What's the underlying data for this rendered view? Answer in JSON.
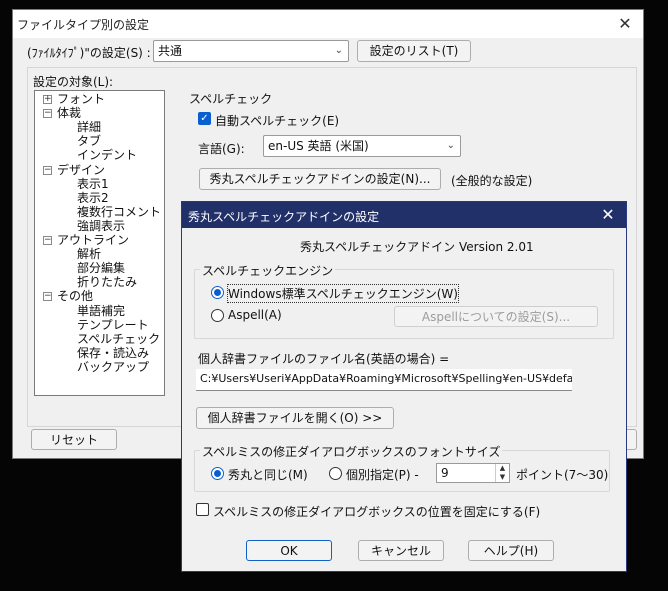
{
  "main_window": {
    "title": "ファイルタイプ別の設定",
    "filetype_label": "(ﾌｧｲﾙﾀｲﾌﾟ)\"の設定(S) :",
    "filetype_value": "共通",
    "settings_list_button": "設定のリスト(T)",
    "target_label": "設定の対象(L):",
    "tree": [
      {
        "label": "フォント",
        "toggle": "+",
        "level": 0
      },
      {
        "label": "体裁",
        "toggle": "−",
        "level": 0
      },
      {
        "label": "詳細",
        "level": 1
      },
      {
        "label": "タブ",
        "level": 1
      },
      {
        "label": "インデント",
        "level": 1
      },
      {
        "label": "デザイン",
        "toggle": "−",
        "level": 0
      },
      {
        "label": "表示1",
        "level": 1
      },
      {
        "label": "表示2",
        "level": 1
      },
      {
        "label": "複数行コメント",
        "level": 1
      },
      {
        "label": "強調表示",
        "level": 1
      },
      {
        "label": "アウトライン",
        "toggle": "−",
        "level": 0
      },
      {
        "label": "解析",
        "level": 1
      },
      {
        "label": "部分編集",
        "level": 1
      },
      {
        "label": "折りたたみ",
        "level": 1
      },
      {
        "label": "その他",
        "toggle": "−",
        "level": 0
      },
      {
        "label": "単語補完",
        "level": 1
      },
      {
        "label": "テンプレート",
        "level": 1
      },
      {
        "label": "スペルチェック",
        "level": 1
      },
      {
        "label": "保存・読込み",
        "level": 1
      },
      {
        "label": "バックアップ",
        "level": 1
      }
    ],
    "spellcheck_section_title": "スペルチェック",
    "auto_spellcheck_label": "自動スペルチェック(E)",
    "language_label": "言語(G):",
    "language_value": "en-US 英語 (米国)",
    "addin_settings_button": "秀丸スペルチェックアドインの設定(N)...",
    "general_settings_note": "(全般的な設定)",
    "reset_button": "リセット"
  },
  "dialog": {
    "title": "秀丸スペルチェックアドインの設定",
    "version": "秀丸スペルチェックアドイン Version 2.01",
    "engine_group": "スペルチェックエンジン",
    "engine_windows": "Windows標準スペルチェックエンジン(W)",
    "engine_aspell": "Aspell(A)",
    "aspell_settings_button": "Aspellについての設定(S)...",
    "dict_label": "個人辞書ファイルのファイル名(英語の場合) =",
    "dict_path": "C:¥Users¥Useri¥AppData¥Roaming¥Microsoft¥Spelling¥en-US¥default.di",
    "open_dict_button": "個人辞書ファイルを開く(O) >>",
    "font_group": "スペルミスの修正ダイアログボックスのフォントサイズ",
    "font_same": "秀丸と同じ(M)",
    "font_custom": "個別指定(P) -",
    "font_size_value": "9",
    "font_unit": "ポイント(7〜30)",
    "fix_position_label": "スペルミスの修正ダイアログボックスの位置を固定にする(F)",
    "ok": "OK",
    "cancel": "キャンセル",
    "help": "ヘルプ(H)"
  },
  "colors": {
    "accent": "#0a5fd0",
    "dialog_title_bg": "#22306a"
  },
  "icons": {
    "close": "close-icon",
    "dropdown": "chevron-down-icon",
    "check": "checkmark-icon"
  }
}
